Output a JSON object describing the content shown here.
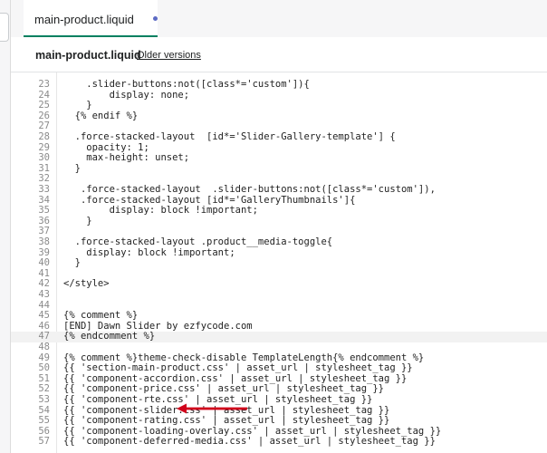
{
  "tab": {
    "label": "main-product.liquid"
  },
  "file_header": {
    "title": "main-product.liquid",
    "older_versions_label": "Older versions"
  },
  "colors": {
    "accent_tab_underline": "#008060",
    "unsaved_dot": "#5c6ac4",
    "annotation_arrow": "#d0021b"
  },
  "editor": {
    "lines": [
      {
        "num": "23",
        "text": "    .slider-buttons:not([class*='custom']){"
      },
      {
        "num": "24",
        "text": "        display: none;"
      },
      {
        "num": "25",
        "text": "    }"
      },
      {
        "num": "26",
        "text": "  {% endif %}"
      },
      {
        "num": "27",
        "text": ""
      },
      {
        "num": "28",
        "text": "  .force-stacked-layout  [id*='Slider-Gallery-template'] {"
      },
      {
        "num": "29",
        "text": "    opacity: 1;"
      },
      {
        "num": "30",
        "text": "    max-height: unset;"
      },
      {
        "num": "31",
        "text": "  }"
      },
      {
        "num": "32",
        "text": ""
      },
      {
        "num": "33",
        "text": "   .force-stacked-layout  .slider-buttons:not([class*='custom']),"
      },
      {
        "num": "34",
        "text": "   .force-stacked-layout [id*='GalleryThumbnails']{"
      },
      {
        "num": "35",
        "text": "        display: block !important;"
      },
      {
        "num": "36",
        "text": "    }"
      },
      {
        "num": "37",
        "text": ""
      },
      {
        "num": "38",
        "text": "  .force-stacked-layout .product__media-toggle{"
      },
      {
        "num": "39",
        "text": "    display: block !important;"
      },
      {
        "num": "40",
        "text": "  }"
      },
      {
        "num": "41",
        "text": ""
      },
      {
        "num": "42",
        "text": "</style>"
      },
      {
        "num": "43",
        "text": ""
      },
      {
        "num": "44",
        "text": ""
      },
      {
        "num": "45",
        "text": "{% comment %}"
      },
      {
        "num": "46",
        "text": "[END] Dawn Slider by ezfycode.com"
      },
      {
        "num": "47",
        "text": "{% endcomment %}"
      },
      {
        "num": "48",
        "text": ""
      },
      {
        "num": "49",
        "text": "{% comment %}theme-check-disable TemplateLength{% endcomment %}"
      },
      {
        "num": "50",
        "text": "{{ 'section-main-product.css' | asset_url | stylesheet_tag }}"
      },
      {
        "num": "51",
        "text": "{{ 'component-accordion.css' | asset_url | stylesheet_tag }}"
      },
      {
        "num": "52",
        "text": "{{ 'component-price.css' | asset_url | stylesheet_tag }}"
      },
      {
        "num": "53",
        "text": "{{ 'component-rte.css' | asset_url | stylesheet_tag }}"
      },
      {
        "num": "54",
        "text": "{{ 'component-slider.css' | asset_url | stylesheet_tag }}"
      },
      {
        "num": "55",
        "text": "{{ 'component-rating.css' | asset_url | stylesheet_tag }}"
      },
      {
        "num": "56",
        "text": "{{ 'component-loading-overlay.css' | asset_url | stylesheet_tag }}"
      },
      {
        "num": "57",
        "text": "{{ 'component-deferred-media.css' | asset_url | stylesheet_tag }}"
      }
    ]
  }
}
